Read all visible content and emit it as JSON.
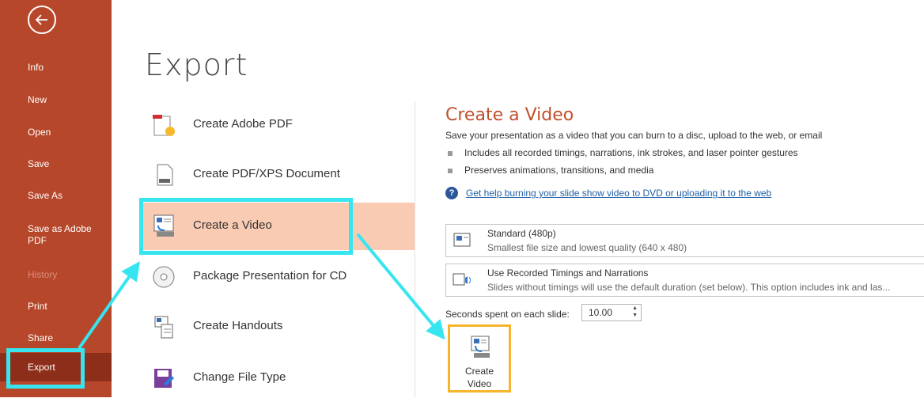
{
  "nav": {
    "items": [
      {
        "label": "Info",
        "state": "normal"
      },
      {
        "label": "New",
        "state": "normal"
      },
      {
        "label": "Open",
        "state": "normal"
      },
      {
        "label": "Save",
        "state": "normal"
      },
      {
        "label": "Save As",
        "state": "normal"
      },
      {
        "label": "Save as Adobe PDF",
        "state": "normal"
      },
      {
        "label": "History",
        "state": "disabled"
      },
      {
        "label": "Print",
        "state": "normal"
      },
      {
        "label": "Share",
        "state": "normal"
      },
      {
        "label": "Export",
        "state": "active"
      }
    ]
  },
  "main": {
    "title": "Export",
    "options": [
      {
        "label": "Create Adobe PDF",
        "icon": "adobe-pdf-icon"
      },
      {
        "label": "Create PDF/XPS Document",
        "icon": "pdf-xps-icon"
      },
      {
        "label": "Create a Video",
        "icon": "video-icon",
        "selected": true
      },
      {
        "label": "Package Presentation for CD",
        "icon": "cd-icon"
      },
      {
        "label": "Create Handouts",
        "icon": "handouts-icon"
      },
      {
        "label": "Change File Type",
        "icon": "file-type-icon"
      }
    ]
  },
  "panel": {
    "title": "Create a Video",
    "description": "Save your presentation as a video that you can burn to a disc, upload to the web, or email",
    "bullets": [
      "Includes all recorded timings, narrations, ink strokes, and laser pointer gestures",
      "Preserves animations, transitions, and media"
    ],
    "help_link": "Get help burning your slide show video to DVD or uploading it to the web",
    "quality": {
      "title": "Standard (480p)",
      "subtitle": "Smallest file size and lowest quality (640 x 480)"
    },
    "timings": {
      "title": "Use Recorded Timings and Narrations",
      "subtitle": "Slides without timings will use the default duration (set below). This option includes ink and las..."
    },
    "seconds_label": "Seconds spent on each slide:",
    "seconds_value": "10.00",
    "create_button": {
      "line1": "Create",
      "line2": "Video"
    }
  },
  "colors": {
    "nav_bg": "#b7472a",
    "nav_active": "#8d2e1a",
    "selected_bg": "#f9cbb2",
    "accent_title": "#c0502d",
    "highlight": "#36e5f0",
    "button_highlight": "#f8b42a"
  }
}
